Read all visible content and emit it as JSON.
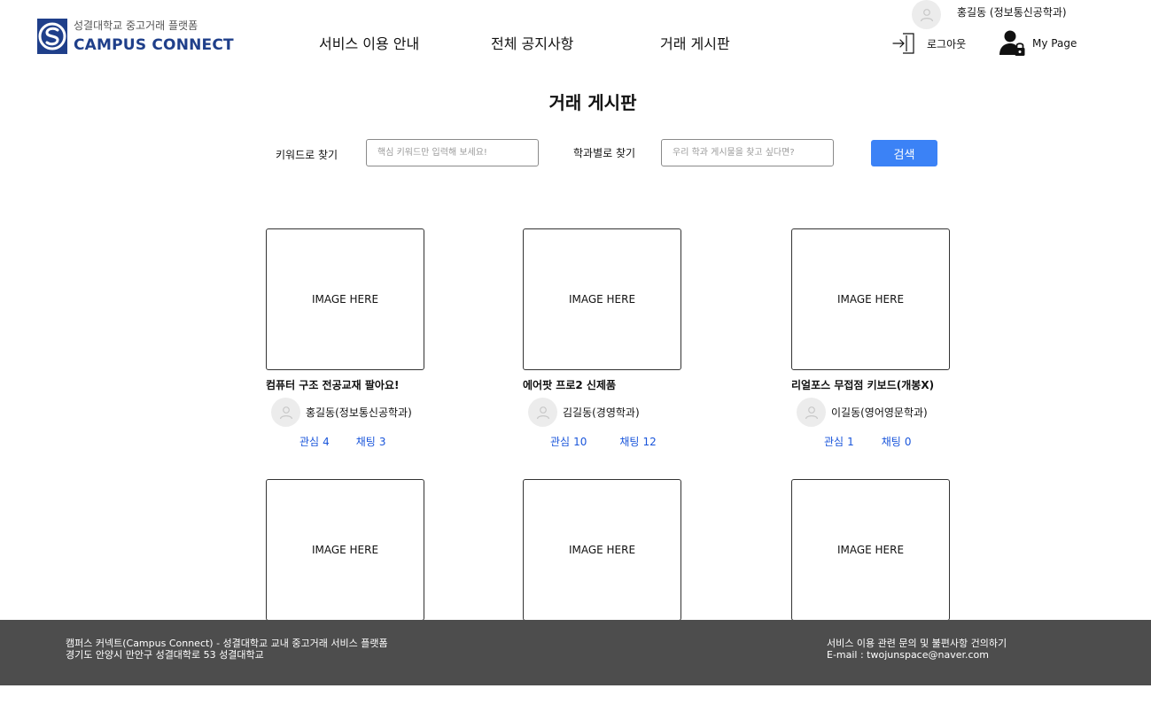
{
  "header": {
    "logo": {
      "subtitle": "성결대학교 중고거래 플랫폼",
      "title": "CAMPUS CONNECT"
    },
    "nav": [
      {
        "label": "서비스 이용 안내"
      },
      {
        "label": "전체 공지사항"
      },
      {
        "label": "거래 게시판"
      }
    ],
    "user_name": "홍길동 (정보통신공학과)",
    "logout_label": "로그아웃",
    "mypage_label": "My Page",
    "brand_color": "#1f3f8a"
  },
  "page_title": "거래 게시판",
  "search": {
    "keyword_label": "키워드로 찾기",
    "keyword_placeholder": "핵심 키워드만 입력해 보세요!",
    "dept_label": "학과별로 찾기",
    "dept_placeholder": "우리 학과 게시물을 찾고 싶다면?",
    "button_label": "검색",
    "button_color": "#3b82f6"
  },
  "cards": [
    {
      "image_text": "IMAGE HERE",
      "title": "컴퓨터 구조 전공교재 팔아요!",
      "seller": "홍길동(정보통신공학과)",
      "interest_label": "관심",
      "interest": "4",
      "chat_label": "채팅",
      "chat": "3"
    },
    {
      "image_text": "IMAGE HERE",
      "title": "에어팟 프로2 신제품",
      "seller": "김길동(경영학과)",
      "interest_label": "관심",
      "interest": "10",
      "chat_label": "채팅",
      "chat": "12"
    },
    {
      "image_text": "IMAGE HERE",
      "title": "리얼포스 무접점 키보드(개봉X)",
      "seller": "이길동(영어영문학과)",
      "interest_label": "관심",
      "interest": "1",
      "chat_label": "채팅",
      "chat": "0"
    },
    {
      "image_text": "IMAGE HERE"
    },
    {
      "image_text": "IMAGE HERE"
    },
    {
      "image_text": "IMAGE HERE"
    }
  ],
  "footer": {
    "line1": "캠퍼스 커넥트(Campus Connect) - 성결대학교 교내 중고거래 서비스 플랫폼",
    "line2": "경기도 안양시 만안구 성결대학로 53 성결대학교",
    "contact_line1": "서비스 이용 관련 문의 및 불편사항 건의하기",
    "contact_line2": "E-mail : twojunspace@naver.com",
    "bg_color": "#4d4d4d"
  }
}
